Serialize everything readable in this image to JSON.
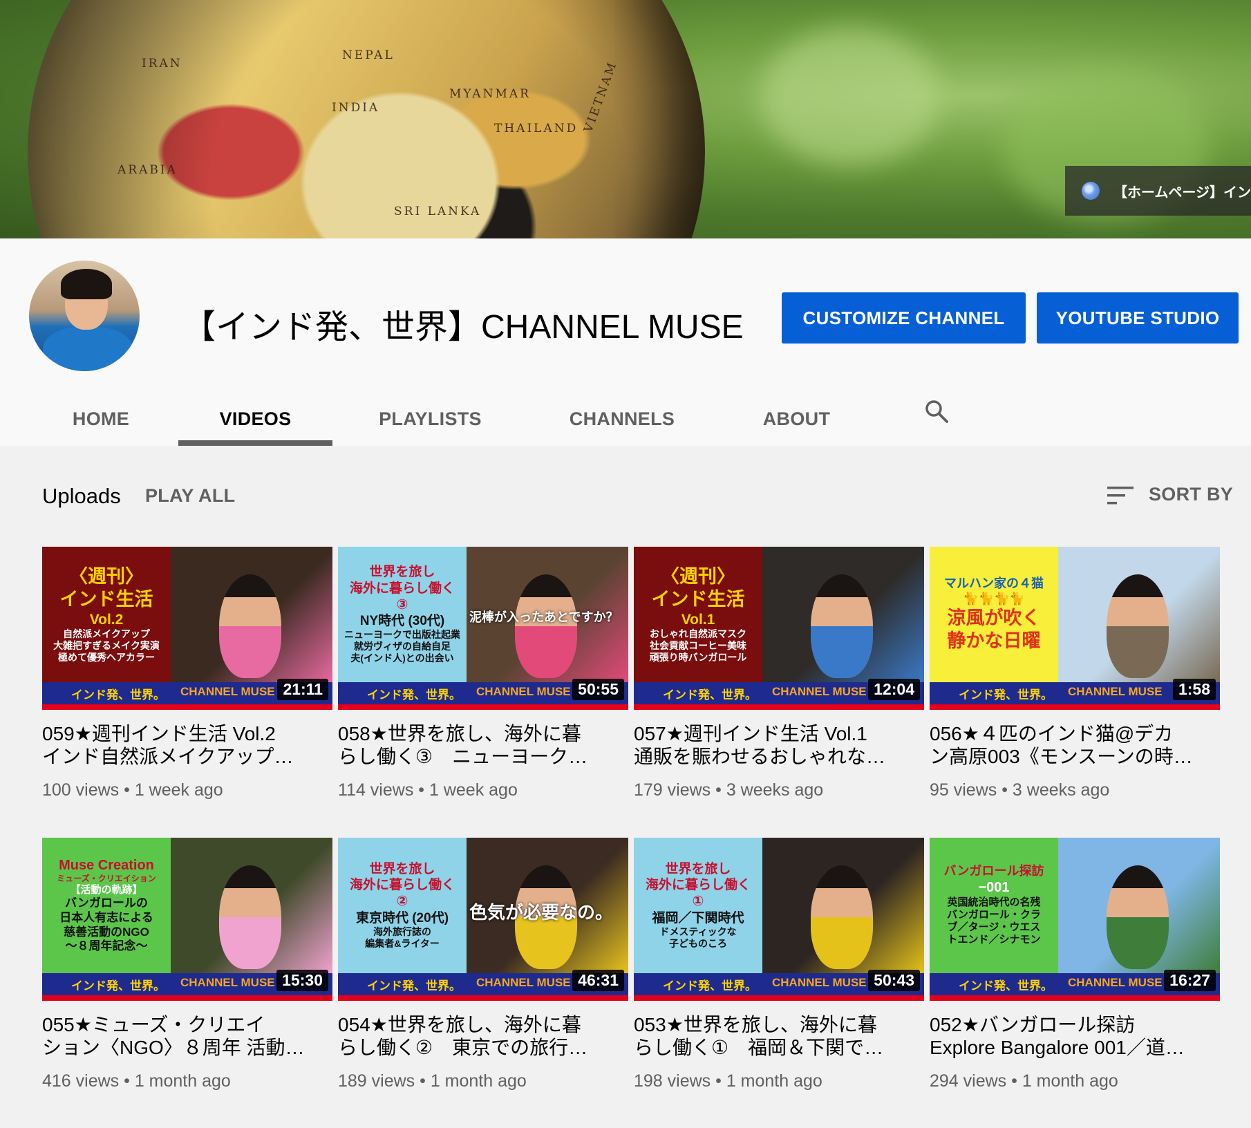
{
  "banner": {
    "link_text": "【ホームページ】イン",
    "globe_labels": [
      "IRAN",
      "ARABIA",
      "INDIA",
      "SRI LANKA",
      "THAILAND",
      "VIETNAM",
      "NEPAL",
      "MYANMAR"
    ]
  },
  "channel": {
    "name": "【インド発、世界】CHANNEL MUSE",
    "customize_label": "CUSTOMIZE CHANNEL",
    "studio_label": "YOUTUBE STUDIO"
  },
  "tabs": [
    {
      "label": "HOME"
    },
    {
      "label": "VIDEOS"
    },
    {
      "label": "PLAYLISTS"
    },
    {
      "label": "CHANNELS"
    },
    {
      "label": "ABOUT"
    }
  ],
  "uploads": {
    "title": "Uploads",
    "play_all": "PLAY ALL",
    "sort_by": "SORT BY"
  },
  "thumb_bar": {
    "left": "インド発、世界。",
    "right": "CHANNEL MUSE"
  },
  "videos": [
    {
      "title_line1": "059★週刊インド生活 Vol.2",
      "title_line2": "インド自然派メイクアップ…",
      "views": "100 views",
      "age": "1 week ago",
      "duration": "21:11",
      "panel": [
        "〈週刊〉",
        "インド生活",
        "Vol.2",
        "自然派メイクアップ",
        "大雑把すぎるメイク実演",
        "極めて優秀ヘアカラー"
      ],
      "panel_color": "#7a0d0d"
    },
    {
      "title_line1": "058★世界を旅し、海外に暮",
      "title_line2": "らし働く③　ニューヨーク…",
      "views": "114 views",
      "age": "1 week ago",
      "duration": "50:55",
      "panel": [
        "世界を旅し",
        "海外に暮らし働く",
        "③",
        "NY時代 (30代)",
        "ニューヨークで出版社起業",
        "就労ヴィザの自給自足",
        "夫(インド人)との出会い"
      ],
      "overlay": "泥棒が入ったあとですか？",
      "panel_color": "#8fd3e8"
    },
    {
      "title_line1": "057★週刊インド生活 Vol.1",
      "title_line2": "通販を賑わせるおしゃれな…",
      "views": "179 views",
      "age": "3 weeks ago",
      "duration": "12:04",
      "panel": [
        "〈週刊〉",
        "インド生活",
        "Vol.1",
        "おしゃれ自然派マスク",
        "社会貢献コーヒー美味",
        "頑張り時バンガロール"
      ],
      "panel_color": "#7a0d0d"
    },
    {
      "title_line1": "056★４匹のインド猫@デカ",
      "title_line2": "ン高原003《モンスーンの時…",
      "views": "95 views",
      "age": "3 weeks ago",
      "duration": "1:58",
      "panel": [
        "マルハン家の４猫",
        "🐈🐈🐈🐈",
        "涼風が吹く",
        "静かな日曜"
      ],
      "panel_color": "#f7ef3a"
    },
    {
      "title_line1": "055★ミューズ・クリエイ",
      "title_line2": "ション〈NGO〉８周年 活動…",
      "views": "416 views",
      "age": "1 month ago",
      "duration": "15:30",
      "panel": [
        "Muse Creation",
        "ミューズ・クリエイション",
        "【活動の軌跡】",
        "バンガロールの",
        "日本人有志による",
        "慈善活動のNGO",
        "〜８周年記念〜"
      ],
      "panel_color": "#5cc64a"
    },
    {
      "title_line1": "054★世界を旅し、海外に暮",
      "title_line2": "らし働く②　東京での旅行…",
      "views": "189 views",
      "age": "1 month ago",
      "duration": "46:31",
      "panel": [
        "世界を旅し",
        "海外に暮らし働く",
        "②",
        "東京時代 (20代)",
        "海外旅行誌の",
        "編集者&ライター"
      ],
      "overlay": "色気が必要なの。",
      "panel_color": "#8fd3e8"
    },
    {
      "title_line1": "053★世界を旅し、海外に暮",
      "title_line2": "らし働く①　福岡＆下関で…",
      "views": "198 views",
      "age": "1 month ago",
      "duration": "50:43",
      "panel": [
        "世界を旅し",
        "海外に暮らし働く",
        "①",
        "福岡／下関時代",
        "ドメスティックな",
        "子どものころ"
      ],
      "panel_color": "#8fd3e8"
    },
    {
      "title_line1": "052★バンガロール探訪",
      "title_line2": "Explore Bangalore 001／道…",
      "views": "294 views",
      "age": "1 month ago",
      "duration": "16:27",
      "panel": [
        "バンガロール探訪",
        "−001",
        "英国統治時代の名残",
        "バンガロール・クラ",
        "ブ／タージ・ウエス",
        "トエンド／シナモン"
      ],
      "panel_color": "#5cc64a"
    }
  ],
  "colors": {
    "accent_blue": "#065fd4",
    "thumb_bar": "#1f2a8f",
    "thumb_strip": "#e3001b"
  }
}
